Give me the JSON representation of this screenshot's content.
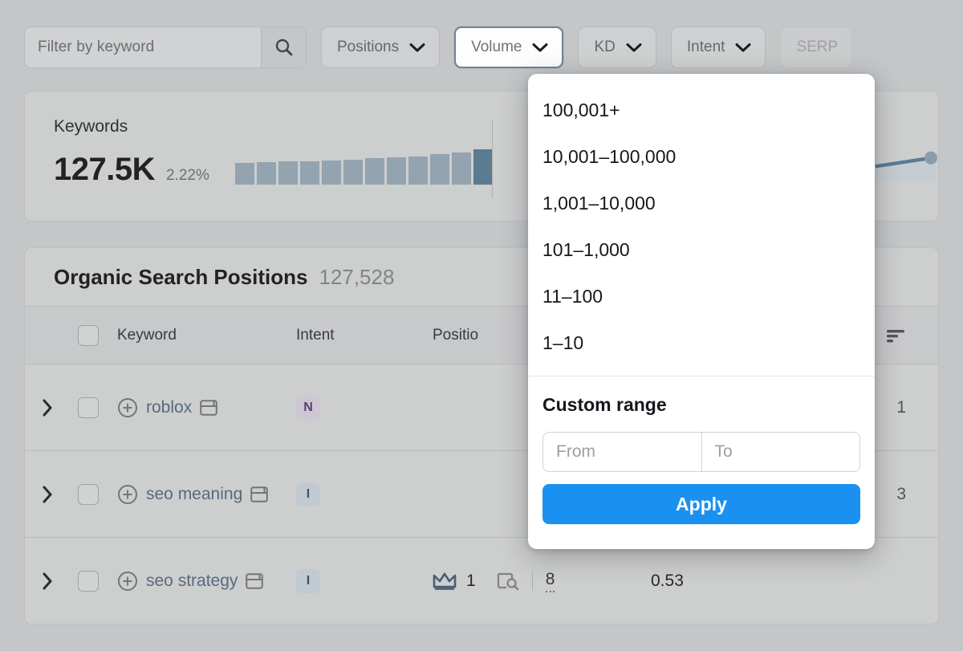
{
  "filters": {
    "search": {
      "placeholder": "Filter by keyword",
      "value": "",
      "icon": "search-icon"
    },
    "chips": [
      {
        "label": "Positions",
        "active": false
      },
      {
        "label": "Volume",
        "active": true
      },
      {
        "label": "KD",
        "active": false
      },
      {
        "label": "Intent",
        "active": false
      },
      {
        "label": "SERP",
        "active": false,
        "clipped": true
      }
    ]
  },
  "summary": {
    "title": "Keywords",
    "value": "127.5K",
    "delta": "2.22%",
    "delta_color": "#3c7a5f",
    "bar_color": "#6fa5ce",
    "bar_color_last": "#1783cd"
  },
  "table": {
    "title": "Organic Search Positions",
    "count": "127,528",
    "columns": {
      "keyword": "Keyword",
      "intent": "Intent",
      "position": "Positio",
      "percent": "%"
    },
    "rows": [
      {
        "keyword": "roblox",
        "intent": "N",
        "intent_kind": "N",
        "trailing": "1"
      },
      {
        "keyword": "seo meaning",
        "intent": "I",
        "intent_kind": "I",
        "trailing": "3"
      },
      {
        "keyword": "seo strategy",
        "intent": "I",
        "intent_kind": "I",
        "position": "1",
        "serp_pos": "8",
        "kd": "0.53",
        "trailing": ""
      }
    ]
  },
  "dropdown": {
    "options": [
      "100,001+",
      "10,001–100,000",
      "1,001–10,000",
      "101–1,000",
      "11–100",
      "1–10"
    ],
    "custom_range_label": "Custom range",
    "from_placeholder": "From",
    "to_placeholder": "To",
    "apply_label": "Apply",
    "apply_color": "#1a91f0"
  }
}
